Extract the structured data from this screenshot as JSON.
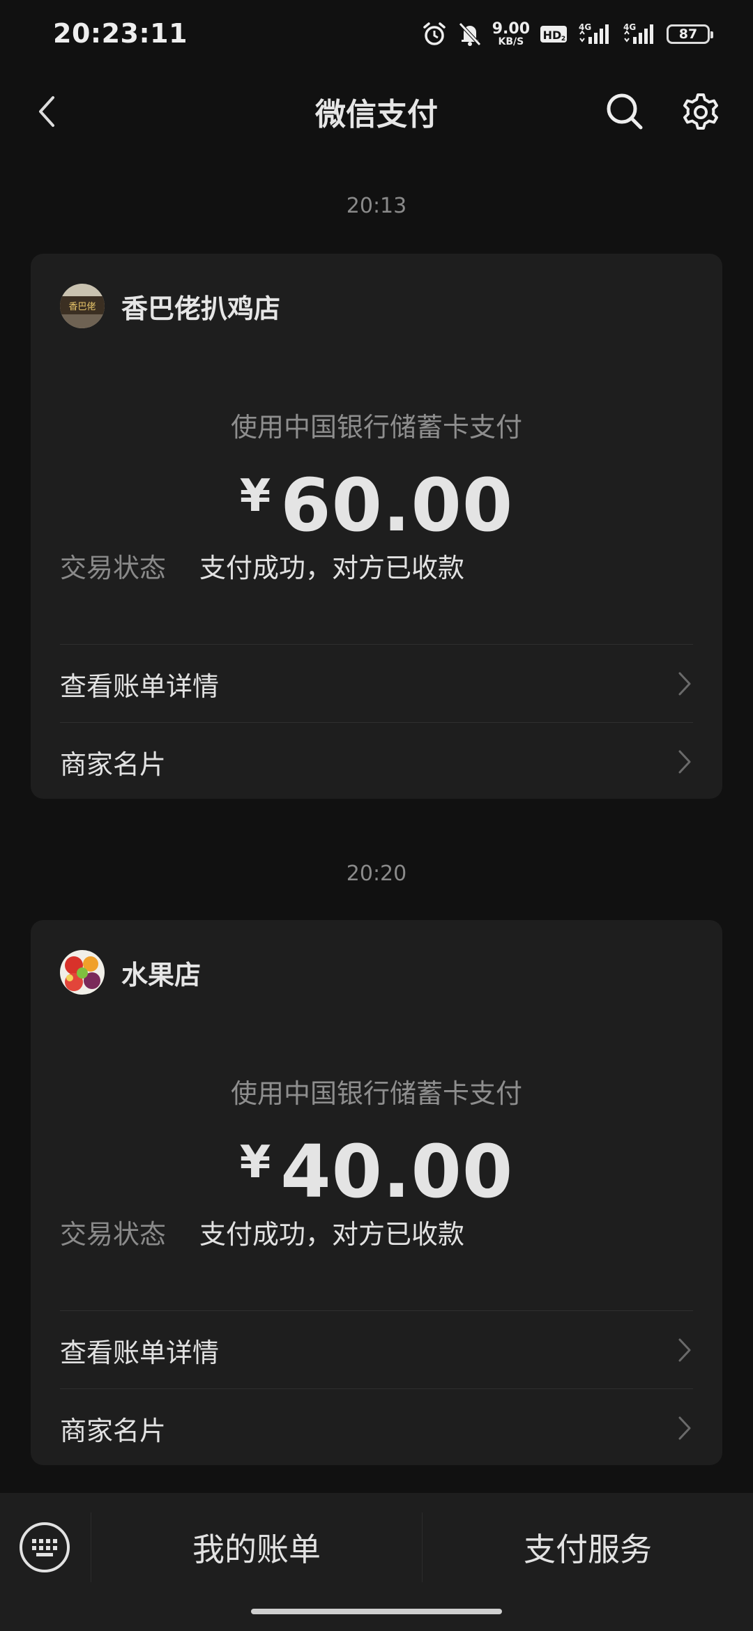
{
  "status_bar": {
    "time": "20:23:11",
    "net_speed_value": "9.00",
    "net_speed_unit": "KB/S",
    "hd_label": "HD2",
    "signal1_label": "4G",
    "signal2_label": "4G",
    "battery": "87",
    "icons": [
      "alarm-icon",
      "mute-icon",
      "hd-icon",
      "signal-4g-icon",
      "signal-4g-icon",
      "battery-icon"
    ]
  },
  "nav": {
    "title": "微信支付",
    "back_icon": "chevron-left-icon",
    "search_icon": "search-icon",
    "settings_icon": "gear-icon"
  },
  "messages": [
    {
      "time": "20:13",
      "merchant": "香巴佬扒鸡店",
      "avatar_text": "香巴佬",
      "pay_method": "使用中国银行储蓄卡支付",
      "currency": "¥",
      "amount": "60.00",
      "status_label": "交易状态",
      "status_value": "支付成功，对方已收款",
      "link_details": "查看账单详情",
      "link_merchant": "商家名片"
    },
    {
      "time": "20:20",
      "merchant": "水果店",
      "avatar_text": "",
      "pay_method": "使用中国银行储蓄卡支付",
      "currency": "¥",
      "amount": "40.00",
      "status_label": "交易状态",
      "status_value": "支付成功，对方已收款",
      "link_details": "查看账单详情",
      "link_merchant": "商家名片"
    }
  ],
  "bottom_bar": {
    "keyboard_icon": "keyboard-icon",
    "menu1": "我的账单",
    "menu2": "支付服务"
  },
  "colors": {
    "background": "#111111",
    "card": "#1e1e1e",
    "text_primary": "#e2e2e2",
    "text_secondary": "#8a8a8a"
  }
}
